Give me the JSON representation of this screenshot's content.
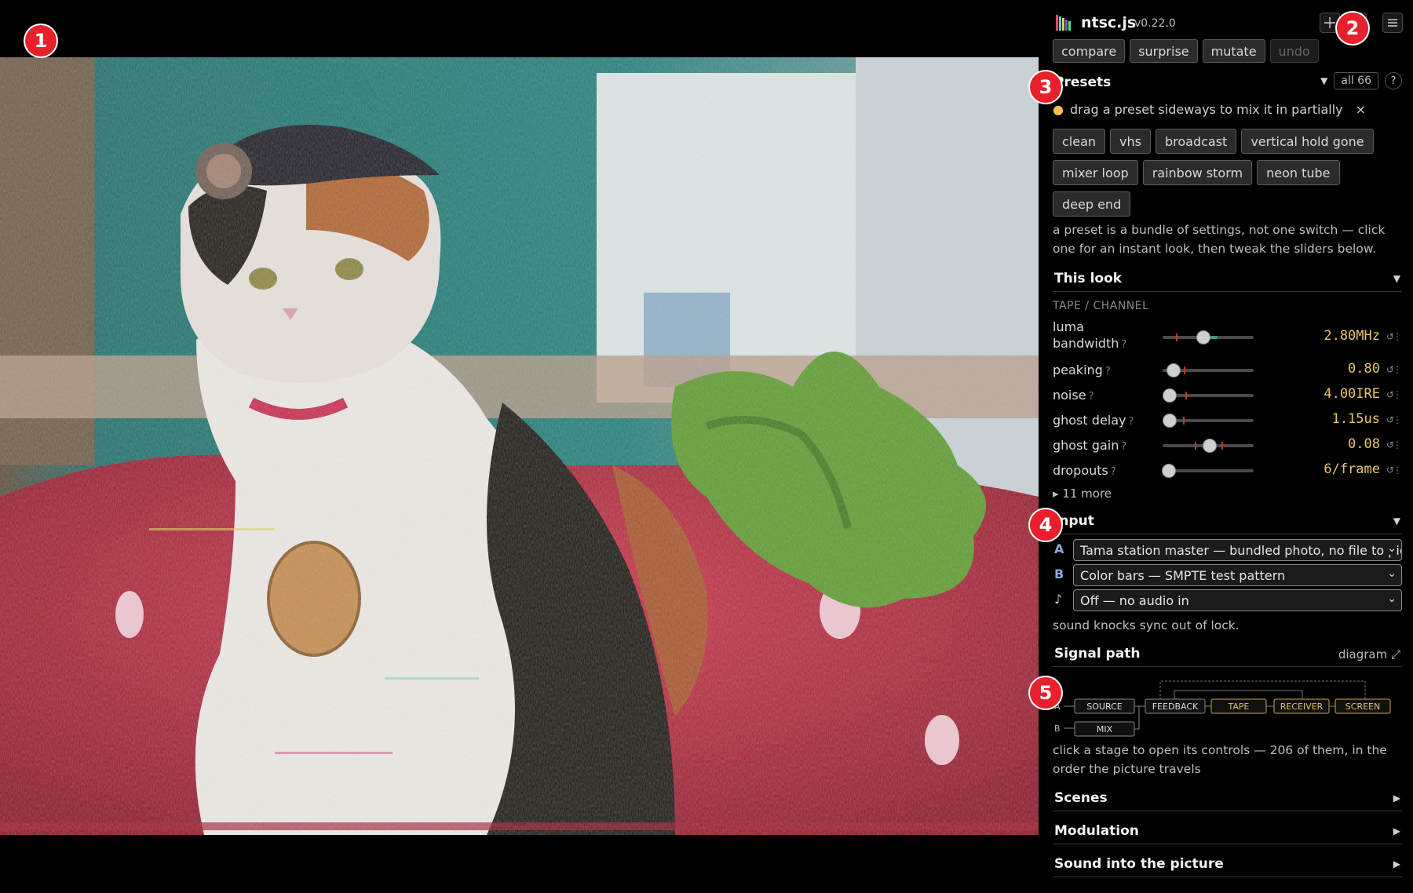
{
  "app": {
    "name": "ntsc.js",
    "version": "v0.22.0"
  },
  "callouts": [
    "1",
    "2",
    "3",
    "4",
    "5"
  ],
  "top_actions": {
    "compare": "compare",
    "surprise": "surprise",
    "mutate": "mutate",
    "undo": "undo"
  },
  "presets": {
    "title": "Presets",
    "all_count": "all 66",
    "help": "?",
    "tip": "drag a preset sideways to mix it in partially",
    "tip_close": "×",
    "items": [
      "clean",
      "vhs",
      "broadcast",
      "vertical hold gone",
      "mixer loop",
      "rainbow storm",
      "neon tube",
      "deep end"
    ],
    "description": "a preset is a bundle of settings, not one switch — click one for an instant look, then tweak the sliders below."
  },
  "this_look": {
    "title": "This look",
    "group": "TAPE / CHANNEL",
    "sliders": [
      {
        "label": "luma bandwidth",
        "value": "2.80MHz",
        "level": 0.45,
        "default": 0.15,
        "fill_color": "#3aa06a",
        "fill_to": 0.6
      },
      {
        "label": "peaking",
        "value": "0.80",
        "level": 0.12,
        "default": 0.23
      },
      {
        "label": "noise",
        "value": "4.00IRE",
        "level": 0.08,
        "default": 0.25
      },
      {
        "label": "ghost delay",
        "value": "1.15us",
        "level": 0.08,
        "default": 0.22
      },
      {
        "label": "ghost gain",
        "value": "0.08",
        "level": 0.52,
        "default": 0.35,
        "default2": 0.65
      },
      {
        "label": "dropouts",
        "value": "6/frame",
        "level": 0.07
      }
    ],
    "more": "▸ 11 more"
  },
  "input": {
    "title": "Input",
    "rows": [
      {
        "key": "A",
        "value": "Tama station master — bundled photo, no file to pick"
      },
      {
        "key": "B",
        "value": "Color bars — SMPTE test pattern"
      },
      {
        "key": "♪",
        "value": "Off — no audio in"
      }
    ],
    "note": "sound knocks sync out of lock."
  },
  "signal_path": {
    "title": "Signal path",
    "diagram_link": "diagram ⤢",
    "nodes": [
      "SOURCE",
      "FEEDBACK",
      "TAPE",
      "RECEIVER",
      "SCREEN",
      "MIX"
    ],
    "inputs": [
      "A",
      "B"
    ],
    "description": "click a stage to open its controls — 206 of them, in the order the picture travels"
  },
  "sections": [
    "Scenes",
    "Modulation",
    "Sound into the picture"
  ],
  "icons": {
    "crosshair": "crosshair-icon",
    "menu": "menu-icon",
    "caret_down": "▼",
    "caret_right": "▶"
  },
  "colors": {
    "accent_value": "#e9c46a",
    "badge": "#e8202c",
    "node_active": "#c9a94a"
  }
}
